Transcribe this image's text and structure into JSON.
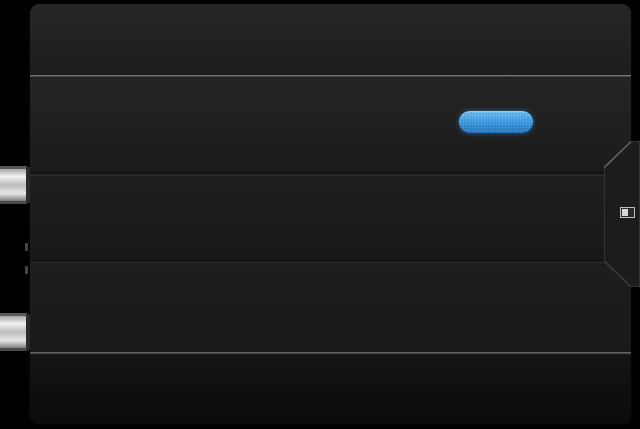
{
  "device": {
    "body_color": "#1a1a1a",
    "led_color": "#2f8fd8",
    "icons": [
      "status-led",
      "slide-switch",
      "rca-connector",
      "rca-connector"
    ]
  }
}
